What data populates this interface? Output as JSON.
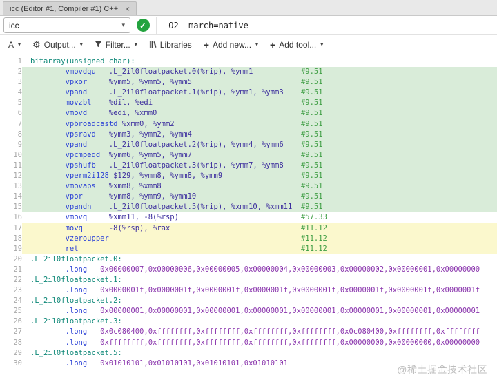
{
  "tab": {
    "title": "icc (Editor #1, Compiler #1) C++",
    "close_icon": "×"
  },
  "toolbar": {
    "compiler": "icc",
    "options": "-O2 -march=native"
  },
  "toolbar2": {
    "font_label": "A",
    "output": "Output...",
    "filter": "Filter...",
    "libraries": "Libraries",
    "add_new": "Add new...",
    "add_tool": "Add tool..."
  },
  "icons": {
    "check": "✓",
    "caret": "▾",
    "gear": "⚙",
    "plus": "+",
    "filter": "funnel-icon",
    "libraries": "books-icon"
  },
  "colors": {
    "status-green": "#23a33f",
    "hl-green": "#d9ecd9",
    "hl-yellow": "#fbf8cd",
    "tk-lbl": "#0f8878",
    "tk-mn": "#2b41d6",
    "tk-op": "#3d2f9e",
    "tk-num": "#8a35ad",
    "tk-cm": "#3f9e44"
  },
  "code": {
    "lines": [
      {
        "n": 1,
        "lbl": "bitarray(unsigned char):"
      },
      {
        "n": 2,
        "bg": "g",
        "mn": "vmovdqu",
        "op": ".L_2il0floatpacket.0(%rip), %ymm1",
        "cm": "#9.51"
      },
      {
        "n": 3,
        "bg": "g",
        "mn": "vpxor",
        "op": "%ymm5, %ymm5, %ymm5",
        "cm": "#9.51"
      },
      {
        "n": 4,
        "bg": "g",
        "mn": "vpand",
        "op": ".L_2il0floatpacket.1(%rip), %ymm1, %ymm3",
        "cm": "#9.51"
      },
      {
        "n": 5,
        "bg": "g",
        "mn": "movzbl",
        "op": "%dil, %edi",
        "cm": "#9.51"
      },
      {
        "n": 6,
        "bg": "g",
        "mn": "vmovd",
        "op": "%edi, %xmm0",
        "cm": "#9.51"
      },
      {
        "n": 7,
        "bg": "g",
        "mn": "vpbroadcastd",
        "op": "%xmm0, %ymm2",
        "cm": "#9.51"
      },
      {
        "n": 8,
        "bg": "g",
        "mn": "vpsravd",
        "op": "%ymm3, %ymm2, %ymm4",
        "cm": "#9.51"
      },
      {
        "n": 9,
        "bg": "g",
        "mn": "vpand",
        "op": ".L_2il0floatpacket.2(%rip), %ymm4, %ymm6",
        "cm": "#9.51"
      },
      {
        "n": 10,
        "bg": "g",
        "mn": "vpcmpeqd",
        "op": "%ymm6, %ymm5, %ymm7",
        "cm": "#9.51"
      },
      {
        "n": 11,
        "bg": "g",
        "mn": "vpshufb",
        "op": ".L_2il0floatpacket.3(%rip), %ymm7, %ymm8",
        "cm": "#9.51"
      },
      {
        "n": 12,
        "bg": "g",
        "mn": "vperm2i128",
        "op": "$129, %ymm8, %ymm8, %ymm9",
        "cm": "#9.51"
      },
      {
        "n": 13,
        "bg": "g",
        "mn": "vmovaps",
        "op": "%xmm8, %xmm8",
        "cm": "#9.51"
      },
      {
        "n": 14,
        "bg": "g",
        "mn": "vpor",
        "op": "%ymm8, %ymm9, %ymm10",
        "cm": "#9.51"
      },
      {
        "n": 15,
        "bg": "g",
        "mn": "vpandn",
        "op": ".L_2il0floatpacket.5(%rip), %xmm10, %xmm11",
        "cm": "#9.51"
      },
      {
        "n": 16,
        "mn": "vmovq",
        "op": "%xmm11, -8(%rsp)",
        "cm": "#57.33"
      },
      {
        "n": 17,
        "bg": "y",
        "mn": "movq",
        "op": "-8(%rsp), %rax",
        "cm": "#11.12"
      },
      {
        "n": 18,
        "bg": "y",
        "mn": "vzeroupper",
        "cm": "#11.12"
      },
      {
        "n": 19,
        "bg": "y",
        "mn": "ret",
        "cm": "#11.12"
      },
      {
        "n": 20,
        "lbl": ".L_2il0floatpacket.0:"
      },
      {
        "n": 21,
        "mn": ".long",
        "num": "0x00000007,0x00000006,0x00000005,0x00000004,0x00000003,0x00000002,0x00000001,0x00000000"
      },
      {
        "n": 22,
        "lbl": ".L_2il0floatpacket.1:"
      },
      {
        "n": 23,
        "mn": ".long",
        "num": "0x0000001f,0x0000001f,0x0000001f,0x0000001f,0x0000001f,0x0000001f,0x0000001f,0x0000001f"
      },
      {
        "n": 24,
        "lbl": ".L_2il0floatpacket.2:"
      },
      {
        "n": 25,
        "mn": ".long",
        "num": "0x00000001,0x00000001,0x00000001,0x00000001,0x00000001,0x00000001,0x00000001,0x00000001"
      },
      {
        "n": 26,
        "lbl": ".L_2il0floatpacket.3:"
      },
      {
        "n": 27,
        "mn": ".long",
        "num": "0x0c080400,0xffffffff,0xffffffff,0xffffffff,0xffffffff,0x0c080400,0xffffffff,0xffffffff"
      },
      {
        "n": 28,
        "mn": ".long",
        "num": "0xffffffff,0xffffffff,0xffffffff,0xffffffff,0xffffffff,0x00000000,0x00000000,0x00000000"
      },
      {
        "n": 29,
        "lbl": ".L_2il0floatpacket.5:"
      },
      {
        "n": 30,
        "mn": ".long",
        "num": "0x01010101,0x01010101,0x01010101,0x01010101"
      }
    ]
  },
  "watermark": "@稀土掘金技术社区"
}
